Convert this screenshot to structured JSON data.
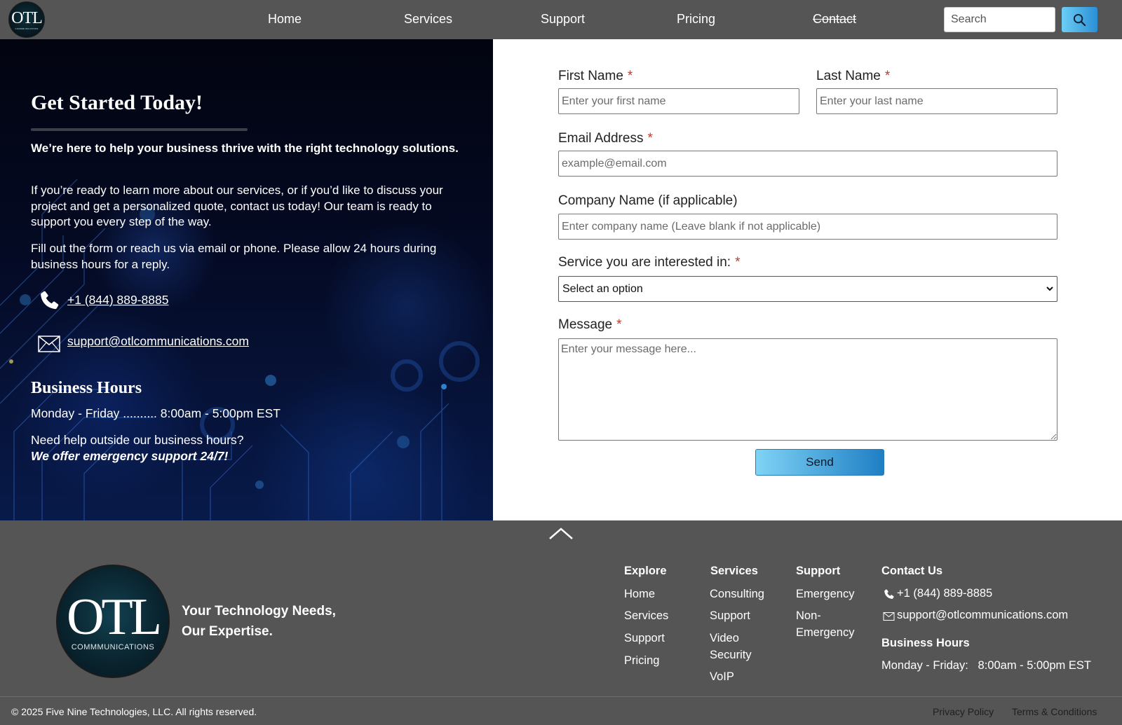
{
  "nav": {
    "logo_text": "OTL",
    "logo_subtext": "COMMMUNICATIONS",
    "links": [
      "Home",
      "Services",
      "Support",
      "Pricing",
      "Contact"
    ],
    "search_placeholder": "Search",
    "search_icon": "search-icon",
    "accent_color": "#2a8fd6"
  },
  "hero": {
    "title": "Get Started Today!",
    "intro": "We’re here to help your business thrive with the right technology solutions.",
    "paragraph1": "If you’re ready to learn more about our services, or if you’d like to discuss your project and get a personalized quote, contact us today! Our team is ready to support you every step of the way.",
    "paragraph2": "Fill out the form or reach us via email or phone. Please allow 24 hours during business hours for a reply.",
    "phone": "+1 (844) 889-8885",
    "email": "support@otlcommunications.com",
    "hours_title": "Business Hours",
    "hours_line": "Monday - Friday .......... 8:00am - 5:00pm EST",
    "after_hours_line1": "Need help outside our business hours?",
    "after_hours_line2": "We offer emergency support 24/7!"
  },
  "form": {
    "first_name_label": "First Name",
    "first_name_placeholder": "Enter your first name",
    "last_name_label": "Last Name",
    "last_name_placeholder": "Enter your last name",
    "email_label": "Email Address",
    "email_placeholder": "example@email.com",
    "company_label": "Company Name (if applicable)",
    "company_placeholder": "Enter company name (Leave blank if not applicable)",
    "service_label": "Service you are interested in:",
    "service_selected": "Select an option",
    "message_label": "Message",
    "message_placeholder": "Enter your message here...",
    "required_mark": "*",
    "send_label": "Send"
  },
  "footer": {
    "logo_text": "OTL",
    "logo_subtext": "COMMMUNICATIONS",
    "tagline_line1": "Your Technology Needs,",
    "tagline_line2": "Our Expertise.",
    "explore": {
      "heading": "Explore",
      "links": [
        "Home",
        "Services",
        "Support",
        "Pricing"
      ]
    },
    "services": {
      "heading": "Services",
      "links": [
        "Consulting",
        "Support",
        "Video Security",
        "VoIP"
      ]
    },
    "support": {
      "heading": "Support",
      "links": [
        "Emergency",
        "Non-Emergency"
      ]
    },
    "contact": {
      "heading": "Contact Us",
      "phone": "+1 (844) 889-8885",
      "email": "support@otlcommunications.com",
      "hours_heading": "Business Hours",
      "hours": "Monday - Friday:   8:00am - 5:00pm EST"
    },
    "copyright": "© 2025 Five Nine Technologies, LLC. All rights reserved.",
    "privacy": "Privacy Policy",
    "terms": "Terms & Conditions"
  }
}
